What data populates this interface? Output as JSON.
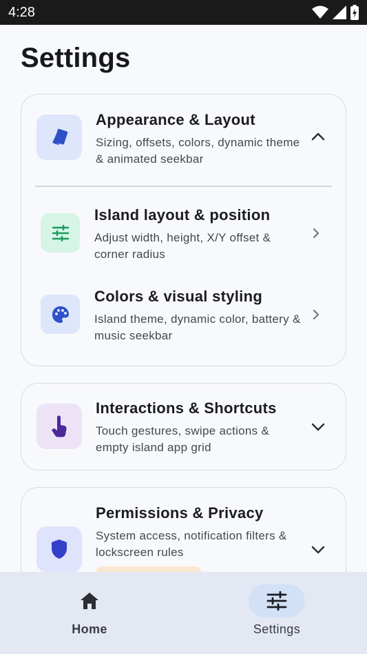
{
  "status_bar": {
    "time": "4:28"
  },
  "page": {
    "title": "Settings"
  },
  "sections": {
    "appearance": {
      "title": "Appearance & Layout",
      "description": "Sizing, offsets, colors, dynamic theme & animated seekbar",
      "icon": "cards-icon",
      "expanded": true,
      "items": [
        {
          "title": "Island layout & position",
          "description": "Adjust width, height, X/Y offset & corner radius",
          "icon": "sliders-icon"
        },
        {
          "title": "Colors & visual styling",
          "description": "Island theme, dynamic color, battery & music seekbar",
          "icon": "palette-icon"
        }
      ]
    },
    "interactions": {
      "title": "Interactions & Shortcuts",
      "description": "Touch gestures, swipe actions & empty island app grid",
      "icon": "touch-icon",
      "expanded": false
    },
    "permissions": {
      "title": "Permissions & Privacy",
      "description": "System access, notification filters & lockscreen rules",
      "icon": "shield-icon",
      "expanded": false
    }
  },
  "bottom_nav": {
    "items": [
      {
        "label": "Home",
        "icon": "home-icon",
        "selected": false
      },
      {
        "label": "Settings",
        "icon": "tune-icon",
        "selected": true
      }
    ]
  },
  "colors": {
    "accent_blue": "#2f50c8",
    "green": "#1c9a5e",
    "purple": "#4a2a9a"
  }
}
